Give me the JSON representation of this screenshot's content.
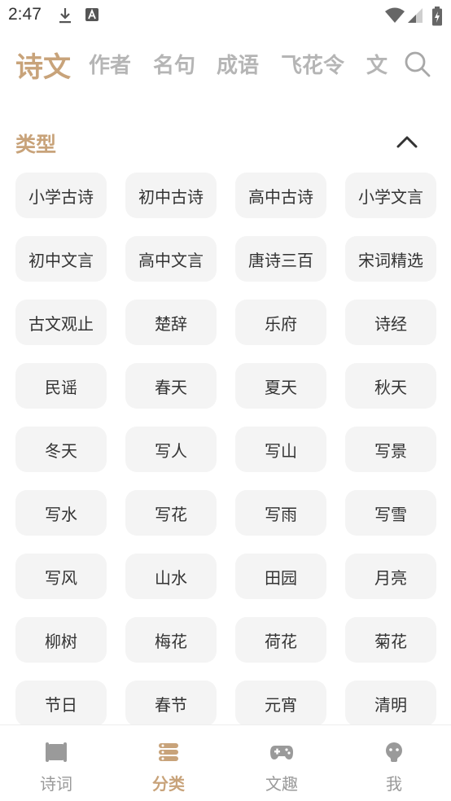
{
  "status_bar": {
    "time": "2:47",
    "icons": [
      "download-icon",
      "a-badge-icon",
      "wifi-icon",
      "signal-icon",
      "battery-icon"
    ]
  },
  "top_tabs": [
    {
      "label": "诗文",
      "active": true
    },
    {
      "label": "作者",
      "active": false
    },
    {
      "label": "名句",
      "active": false
    },
    {
      "label": "成语",
      "active": false
    },
    {
      "label": "飞花令",
      "active": false
    },
    {
      "label": "文",
      "active": false
    }
  ],
  "section": {
    "title": "类型",
    "collapse_icon": "chevron-up-icon"
  },
  "tags": [
    "小学古诗",
    "初中古诗",
    "高中古诗",
    "小学文言",
    "初中文言",
    "高中文言",
    "唐诗三百",
    "宋词精选",
    "古文观止",
    "楚辞",
    "乐府",
    "诗经",
    "民谣",
    "春天",
    "夏天",
    "秋天",
    "冬天",
    "写人",
    "写山",
    "写景",
    "写水",
    "写花",
    "写雨",
    "写雪",
    "写风",
    "山水",
    "田园",
    "月亮",
    "柳树",
    "梅花",
    "荷花",
    "菊花",
    "节日",
    "春节",
    "元宵",
    "清明"
  ],
  "bottom_nav": [
    {
      "label": "诗词",
      "icon": "scroll-icon",
      "active": false
    },
    {
      "label": "分类",
      "icon": "category-icon",
      "active": true
    },
    {
      "label": "文趣",
      "icon": "gamepad-icon",
      "active": false
    },
    {
      "label": "我",
      "icon": "profile-icon",
      "active": false
    }
  ],
  "colors": {
    "accent": "#c8a37a",
    "inactive": "#b5b5b5",
    "tag_bg": "#f4f4f4",
    "nav_inactive": "#9a9a9a"
  }
}
